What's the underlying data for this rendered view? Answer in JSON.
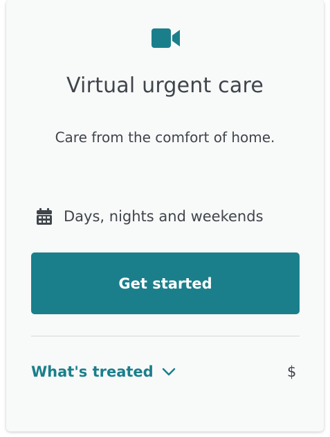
{
  "card": {
    "icon": "video-camera-icon",
    "title": "Virtual urgent care",
    "subtitle": "Care from the comfort of home.",
    "hours": {
      "icon": "calendar-icon",
      "text": "Days, nights and weekends"
    },
    "cta_label": "Get started",
    "treated": {
      "label": "What's treated",
      "icon": "chevron-down-icon"
    },
    "cost": "$"
  },
  "colors": {
    "accent": "#1a7f8b",
    "text": "#3f454b",
    "card_background": "#f8f9f9",
    "divider": "#d4d9db"
  }
}
